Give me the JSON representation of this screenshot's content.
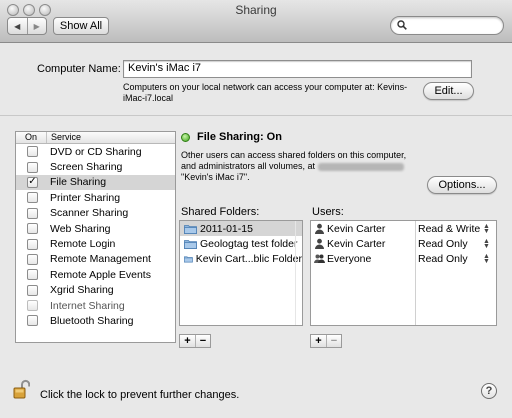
{
  "window": {
    "title": "Sharing"
  },
  "toolbar": {
    "show_all_label": "Show All",
    "back_icon": "◀",
    "forward_icon": "▶",
    "search_placeholder": ""
  },
  "computer": {
    "label": "Computer Name:",
    "value": "Kevin's iMac i7",
    "note": "Computers on your local network can access your computer at: Kevins-iMac-i7.local",
    "edit_label": "Edit..."
  },
  "services": {
    "col_on": "On",
    "col_service": "Service",
    "items": [
      {
        "label": "DVD or CD Sharing",
        "checked": false,
        "enabled": true
      },
      {
        "label": "Screen Sharing",
        "checked": false,
        "enabled": true
      },
      {
        "label": "File Sharing",
        "checked": true,
        "enabled": true,
        "selected": true
      },
      {
        "label": "Printer Sharing",
        "checked": false,
        "enabled": true
      },
      {
        "label": "Scanner Sharing",
        "checked": false,
        "enabled": true
      },
      {
        "label": "Web Sharing",
        "checked": false,
        "enabled": true
      },
      {
        "label": "Remote Login",
        "checked": false,
        "enabled": true
      },
      {
        "label": "Remote Management",
        "checked": false,
        "enabled": true
      },
      {
        "label": "Remote Apple Events",
        "checked": false,
        "enabled": true
      },
      {
        "label": "Xgrid Sharing",
        "checked": false,
        "enabled": true
      },
      {
        "label": "Internet Sharing",
        "checked": false,
        "enabled": false
      },
      {
        "label": "Bluetooth Sharing",
        "checked": false,
        "enabled": true
      }
    ]
  },
  "detail": {
    "status": "File Sharing: On",
    "description_line1": "Other users can access shared folders on this computer,",
    "description_line2": "and administrators all volumes, at",
    "description_line3": "\"Kevin's iMac i7\".",
    "options_label": "Options...",
    "shared_folders_label": "Shared Folders:",
    "users_label": "Users:",
    "folders": [
      "2011-01-15",
      "Geologtag test folder",
      "Kevin Cart...blic Folder"
    ],
    "users": [
      {
        "name": "Kevin Carter",
        "permission": "Read & Write"
      },
      {
        "name": "Kevin Carter",
        "permission": "Read Only"
      },
      {
        "name": "Everyone",
        "permission": "Read Only"
      }
    ],
    "add_label": "+",
    "remove_label": "−"
  },
  "footer": {
    "lock_text": "Click the lock to prevent further changes.",
    "help_label": "?"
  }
}
